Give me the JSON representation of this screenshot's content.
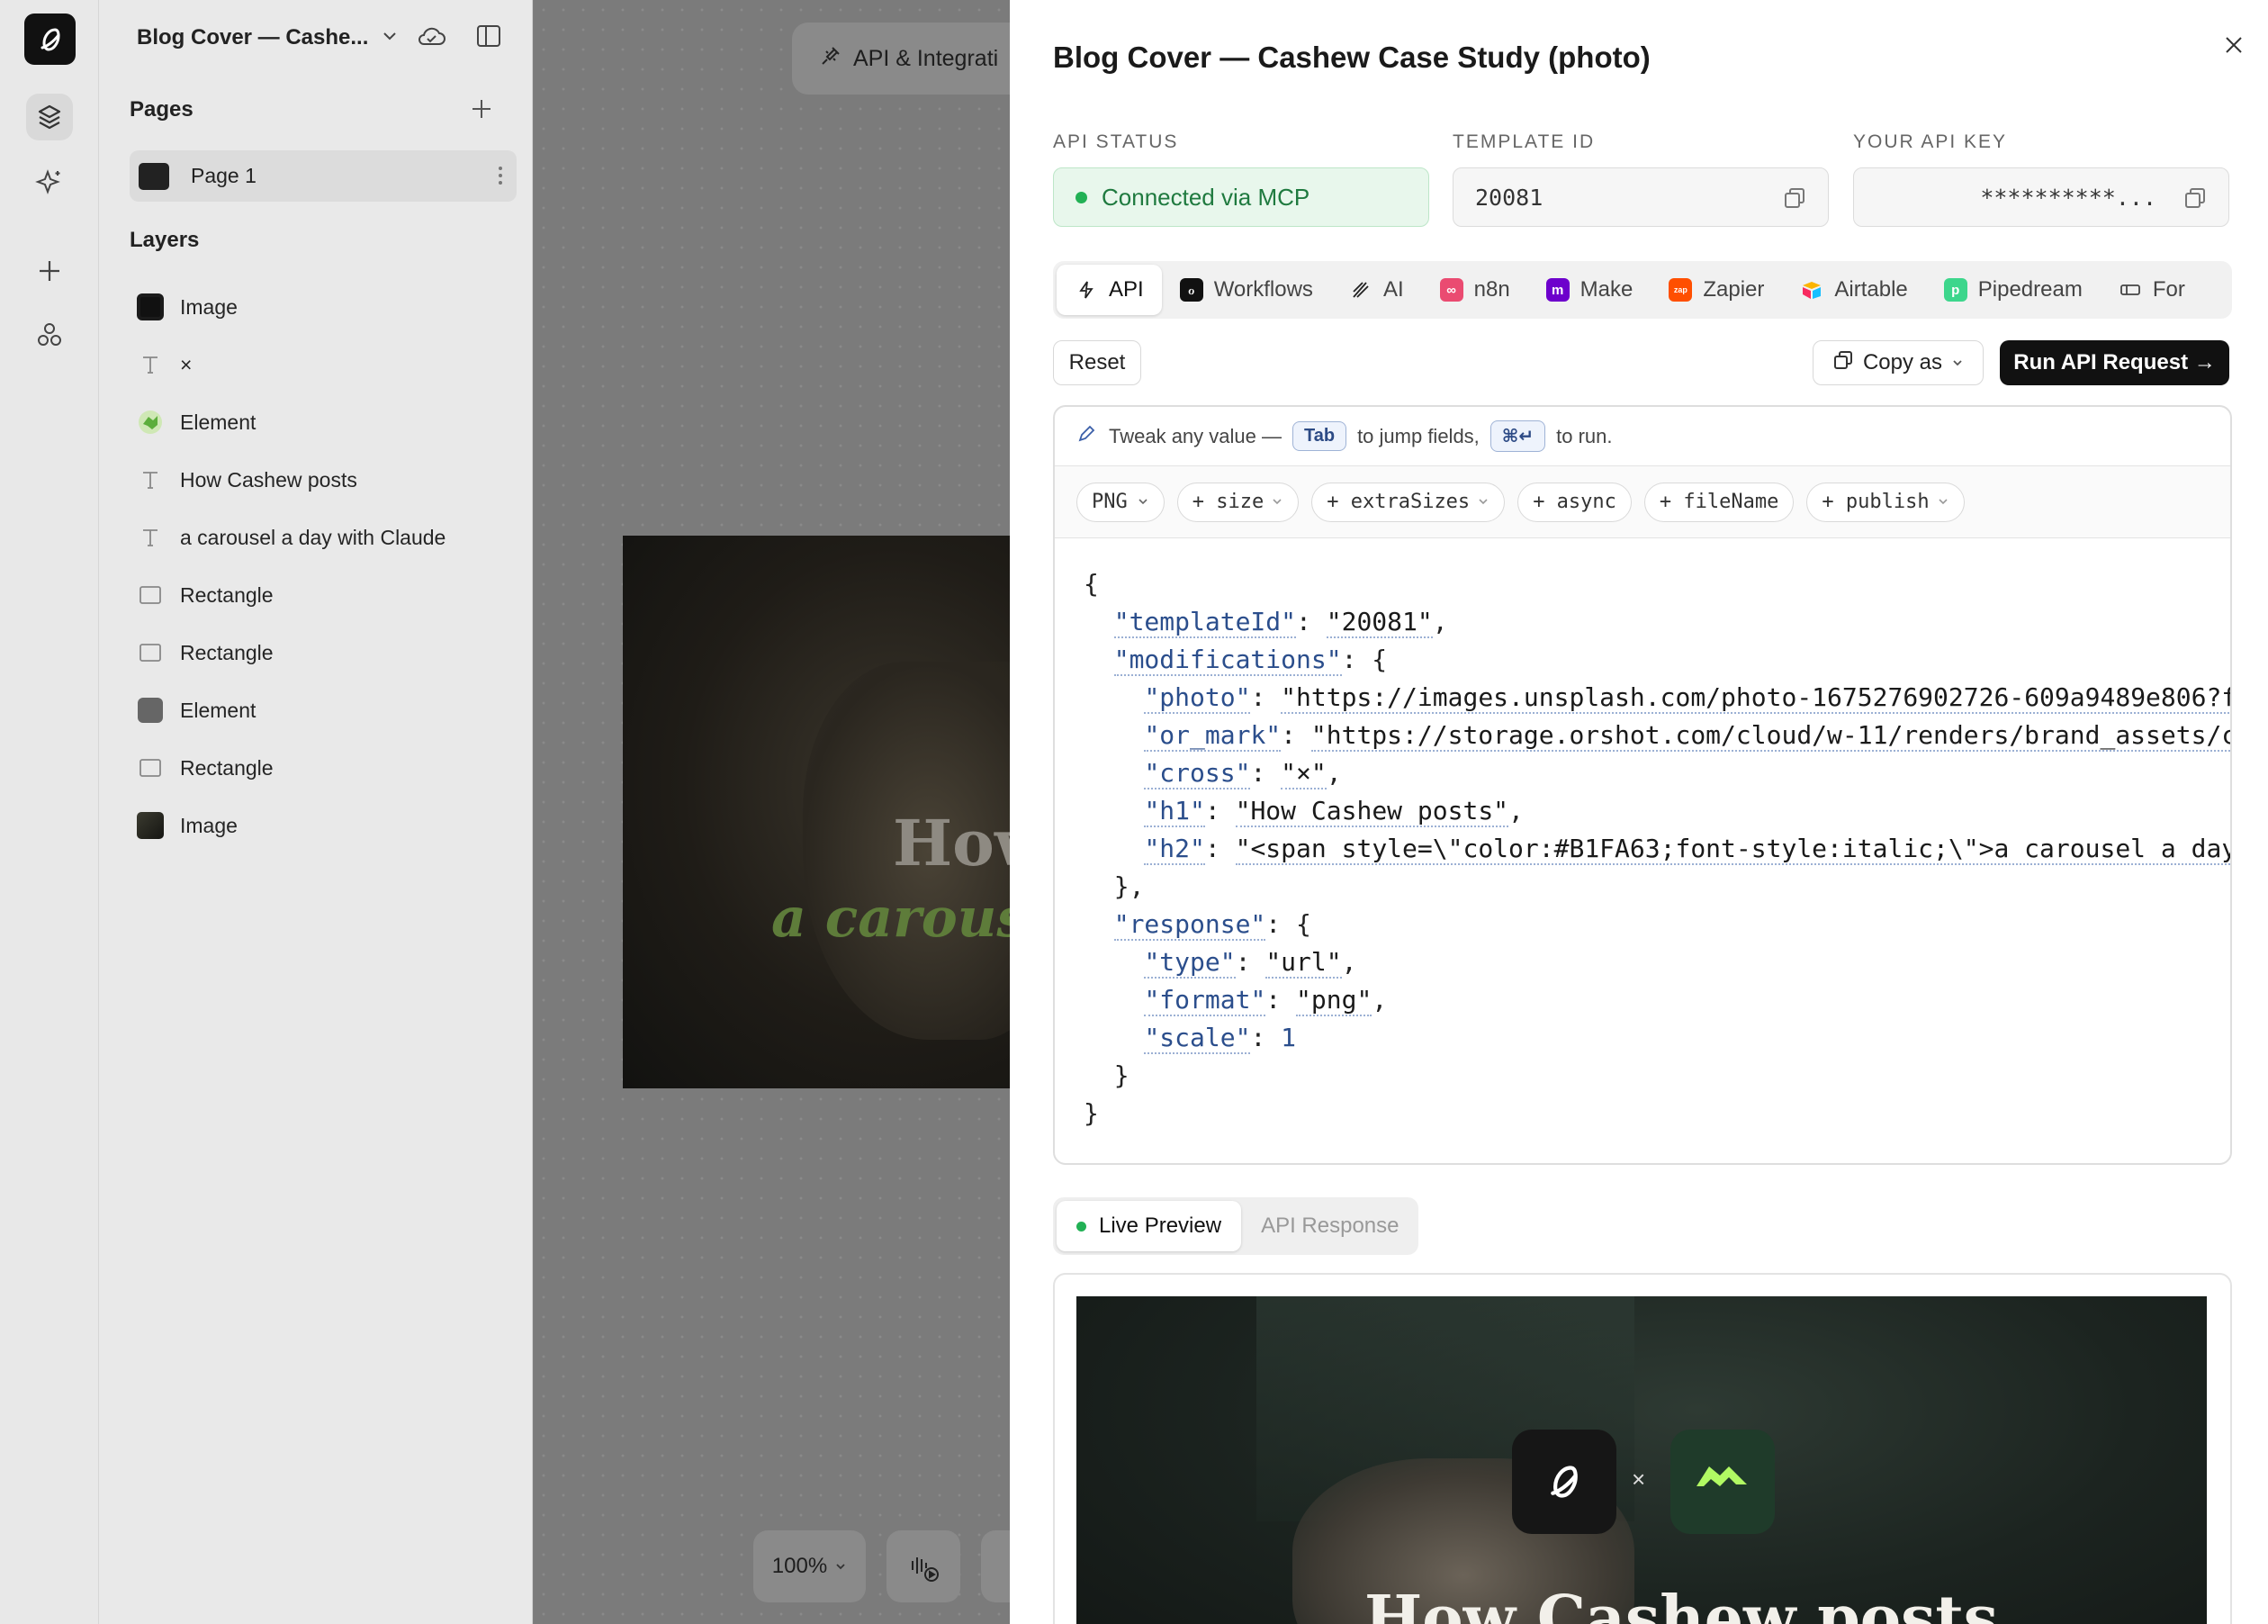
{
  "app": {
    "doc_title": "Blog Cover — Cashe..."
  },
  "pages": {
    "heading": "Pages",
    "items": [
      {
        "label": "Page 1"
      }
    ]
  },
  "layers": {
    "heading": "Layers",
    "items": [
      {
        "label": "Image",
        "icon": "app-logo-thumb-icon"
      },
      {
        "label": "×",
        "icon": "text-icon"
      },
      {
        "label": "Element",
        "icon": "element-logo-icon"
      },
      {
        "label": "How Cashew posts",
        "icon": "text-icon"
      },
      {
        "label": "a carousel a day with Claude",
        "icon": "text-icon"
      },
      {
        "label": "Rectangle",
        "icon": "rectangle-icon"
      },
      {
        "label": "Rectangle",
        "icon": "rectangle-icon"
      },
      {
        "label": "Element",
        "icon": "element-thumb-icon"
      },
      {
        "label": "Rectangle",
        "icon": "rectangle-icon"
      },
      {
        "label": "Image",
        "icon": "photo-thumb-icon"
      }
    ]
  },
  "canvas": {
    "api_pill_label": "API & Integrati",
    "art_h1": "How",
    "art_h2": "a carouse",
    "zoom": "100%",
    "colors": {
      "h2": "#5e7c3a"
    }
  },
  "modal": {
    "title": "Blog Cover — Cashew Case Study (photo)",
    "api_status_label": "API STATUS",
    "api_status_value": "Connected via MCP",
    "template_id_label": "TEMPLATE ID",
    "template_id_value": "20081",
    "api_key_label": "YOUR API KEY",
    "api_key_value": "**********...",
    "tabs": [
      {
        "label": "API",
        "icon": "bolt-icon"
      },
      {
        "label": "Workflows",
        "icon": "workflows-icon"
      },
      {
        "label": "AI",
        "icon": "ai-icon"
      },
      {
        "label": "n8n",
        "icon": "n8n-icon"
      },
      {
        "label": "Make",
        "icon": "make-icon"
      },
      {
        "label": "Zapier",
        "icon": "zapier-icon"
      },
      {
        "label": "Airtable",
        "icon": "airtable-icon"
      },
      {
        "label": "Pipedream",
        "icon": "pipedream-icon"
      },
      {
        "label": "For",
        "icon": "form-icon"
      }
    ],
    "reset_label": "Reset",
    "copy_as_label": "Copy as",
    "run_label": "Run API Request →",
    "hint": {
      "prefix": "Tweak any value —",
      "tab_key": "Tab",
      "middle": "to jump fields,",
      "run_key": "⌘↵",
      "suffix": "to run."
    },
    "chips": [
      "PNG",
      "+ size",
      "+ extraSizes",
      "+ async",
      "+ fileName",
      "+ publish"
    ],
    "code": {
      "templateId": "20081",
      "photo": "https://images.unsplash.com/photo-1675276902726-609a9489e806?f",
      "or_mark": "https://storage.orshot.com/cloud/w-11/renders/brand_assets/c",
      "cross": "×",
      "h1": "How Cashew posts",
      "h2": "<span style=\\\"color:#B1FA63;font-style:italic;\\\">a carousel a day",
      "type": "url",
      "format": "png",
      "scale": "1"
    },
    "preview_tabs": [
      {
        "label": "Live Preview"
      },
      {
        "label": "API Response"
      }
    ],
    "preview": {
      "cross": "×",
      "h1": "How Cashew posts"
    }
  },
  "colors": {
    "status_green": "#22b155",
    "run_button": "#111111",
    "accent_lime": "#B1FA63"
  }
}
